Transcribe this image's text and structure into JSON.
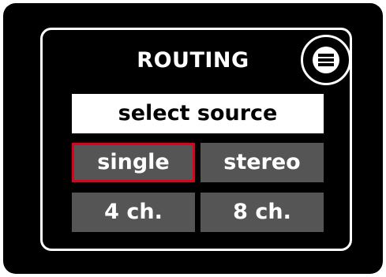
{
  "routing": {
    "title": "ROUTING",
    "menu_icon": "hamburger-menu-icon",
    "source_label": "select source",
    "options": [
      {
        "label": "single",
        "selected": true
      },
      {
        "label": "stereo",
        "selected": false
      },
      {
        "label": "4 ch.",
        "selected": false
      },
      {
        "label": "8 ch.",
        "selected": false
      }
    ],
    "colors": {
      "background": "#000000",
      "option_bg": "#555555",
      "selected_border": "#e0001b",
      "label_bg": "#ffffff"
    }
  }
}
